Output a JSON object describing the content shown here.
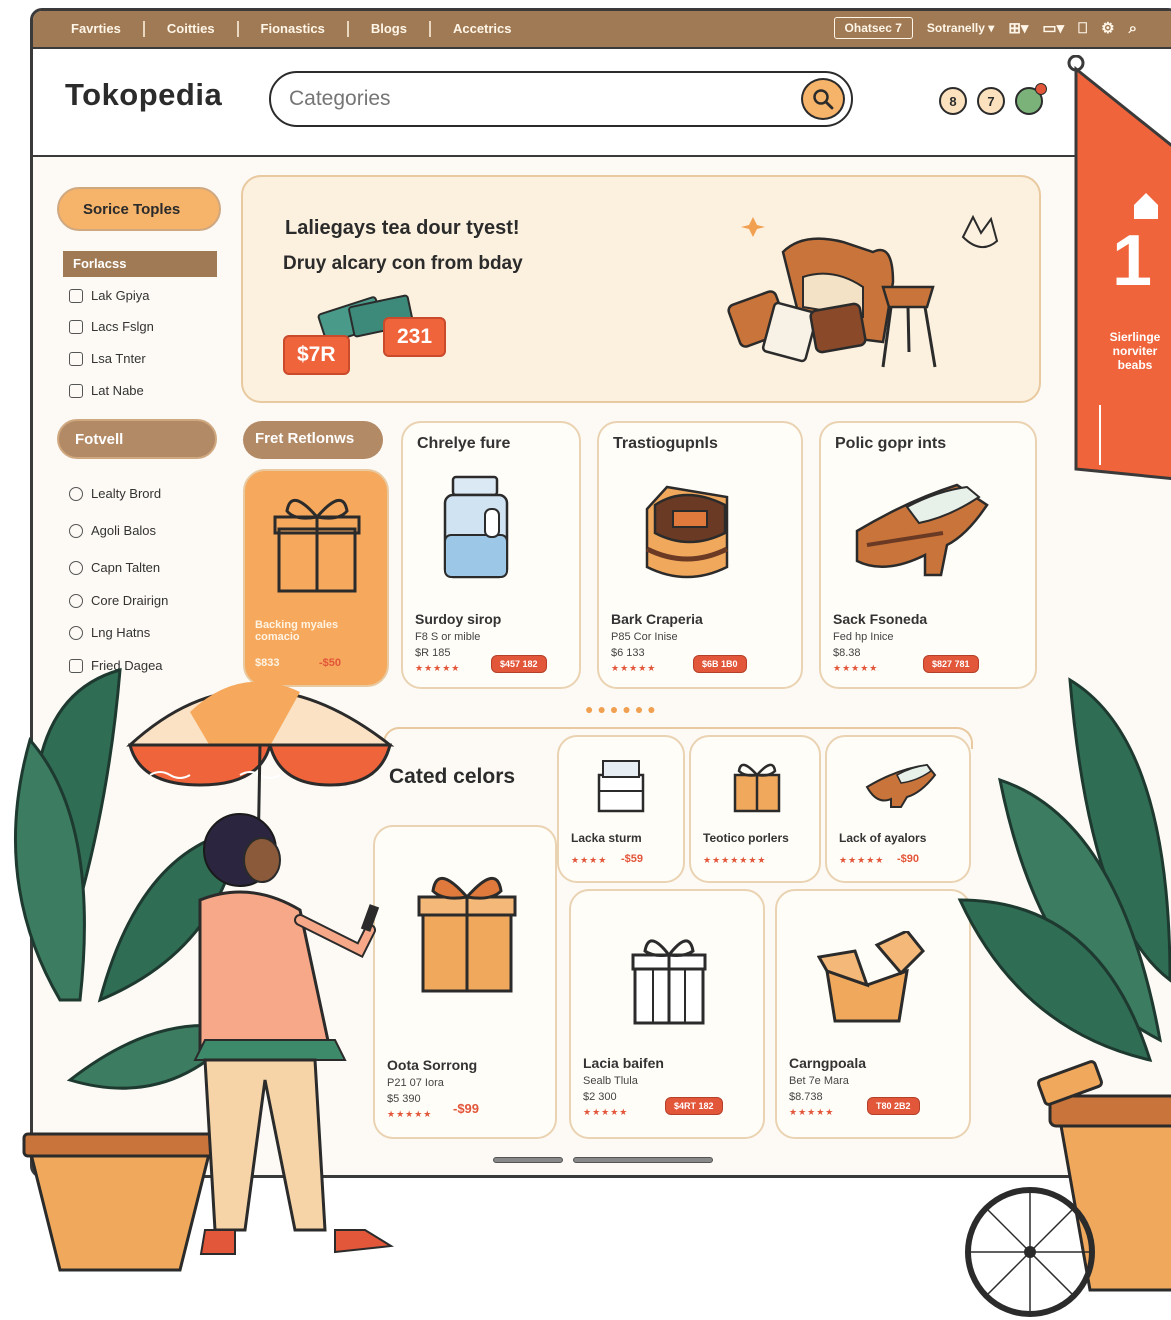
{
  "topbar": {
    "nav": [
      "Favrties",
      "Coitties",
      "Fionastics",
      "Blogs",
      "Accetrics"
    ],
    "pill": "Ohatsec 7",
    "dropdown": "Sotranelly",
    "icons": [
      "grid-icon",
      "screen-icon",
      "bag-icon",
      "settings-icon",
      "search-icon"
    ]
  },
  "header": {
    "logo": "Tokopedia",
    "search_placeholder": "Categories",
    "icon_badge_user": "8",
    "icon_badge_help": "7"
  },
  "sidebar": {
    "top_pill": "Sorice Toples",
    "bar": "Forlacss",
    "group1": [
      "Lak Gpiya",
      "Lacs Fslgn",
      "Lsa Tnter",
      "Lat Nabe"
    ],
    "mid_pill": "Fotvell",
    "group2": [
      "Lealty Brord",
      "Agoli Balos",
      "Capn Talten",
      "Core Drairign",
      "Lng Hatns",
      "Fried Dagea"
    ]
  },
  "banner": {
    "title": "Laliegays tea dour tyest!",
    "subtitle": "Druy alcary con from bday",
    "price1": "$7R",
    "price2": "231"
  },
  "featured": {
    "pill": "Fret Retlonws",
    "text": "Backing myales comacio",
    "price": "$833",
    "price_red": "-$50"
  },
  "cards": [
    {
      "title": "Chrelye fure",
      "name": "Surdoy sirop",
      "sub": "F8 S or mible",
      "price": "$R 185",
      "btn": "$457 182"
    },
    {
      "title": "Trastiogupnls",
      "name": "Bark Craperia",
      "sub": "P85 Cor Inise",
      "price": "$6 133",
      "btn": "$6B 1B0"
    },
    {
      "title": "Polic gopr ints",
      "name": "Sack Fsoneda",
      "sub": "Fed hp Inice",
      "price": "$8.38",
      "btn": "$827 781"
    }
  ],
  "section": {
    "title": "Cated celors"
  },
  "small_cards": [
    {
      "name": "Lacka sturm",
      "price": "-$59"
    },
    {
      "name": "Teotico porlers",
      "price": ""
    },
    {
      "name": "Lack of ayalors",
      "price": "-$90"
    }
  ],
  "bottom_cards": [
    {
      "name": "Oota Sorrong",
      "sub": "P21 07 Iora",
      "price": "$5 390",
      "price_red": "-$99"
    },
    {
      "name": "Lacia baifen",
      "sub": "Sealb Tlula",
      "price": "$2 300",
      "btn": "$4RT 182"
    },
    {
      "name": "Carngpoala",
      "sub": "Bet 7e Mara",
      "price": "$8.738",
      "btn": "T80 2B2"
    }
  ],
  "flag": {
    "number": "1",
    "text_line1": "Sierlinge",
    "text_line2": "norviter",
    "text_line3": "beabs"
  },
  "colors": {
    "accent_orange": "#f6b36a",
    "accent_red": "#e2563a",
    "brown": "#a07a55",
    "cream": "#fcf1df"
  }
}
